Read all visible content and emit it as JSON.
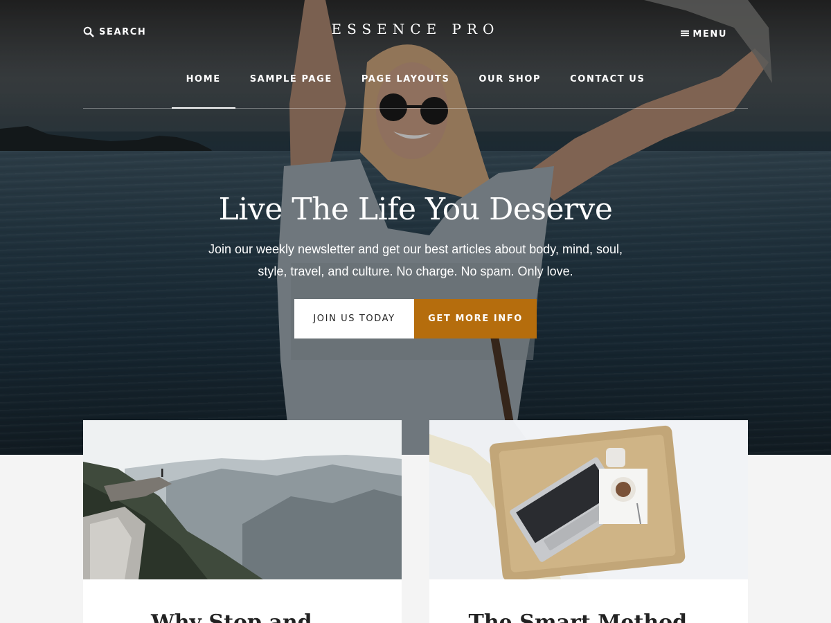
{
  "header": {
    "search_label": "SEARCH",
    "site_title": "ESSENCE PRO",
    "menu_label": "MENU"
  },
  "nav": {
    "items": [
      {
        "label": "HOME",
        "active": true
      },
      {
        "label": "SAMPLE PAGE",
        "active": false
      },
      {
        "label": "PAGE LAYOUTS",
        "active": false
      },
      {
        "label": "OUR SHOP",
        "active": false
      },
      {
        "label": "CONTACT US",
        "active": false
      }
    ]
  },
  "hero": {
    "title": "Live The Life You Deserve",
    "text": "Join our weekly newsletter and get our best articles about body, mind, soul, style, travel, and culture. No charge. No spam. Only love.",
    "primary_button": "JOIN US TODAY",
    "secondary_button": "GET MORE INFO"
  },
  "cards": [
    {
      "title": "Why Stop and..."
    },
    {
      "title": "The Smart Method..."
    }
  ],
  "colors": {
    "accent": "#b56d0d",
    "page_background": "#f4f4f4"
  },
  "icons": {
    "search": "search-icon",
    "menu": "hamburger-icon"
  }
}
